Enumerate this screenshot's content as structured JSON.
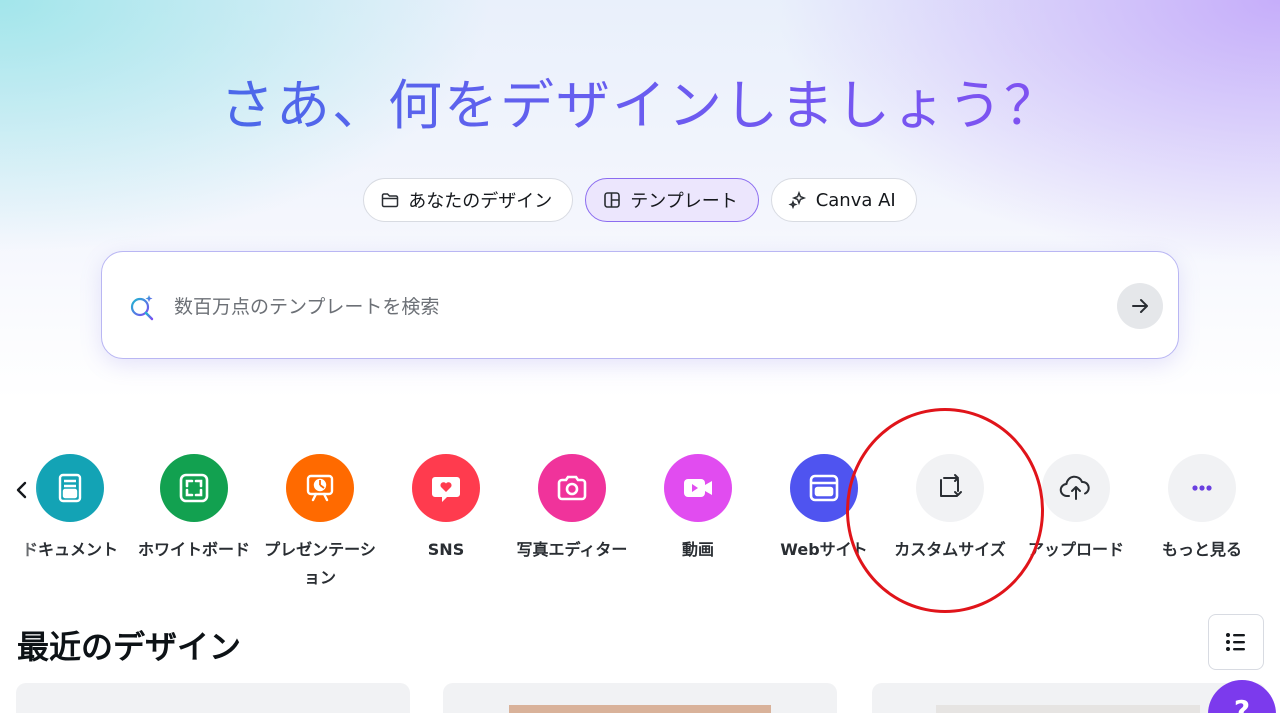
{
  "hero": {
    "headline": "さあ、何をデザインしましょう？"
  },
  "tabs": [
    {
      "label": "あなたのデザイン",
      "icon": "folder-icon",
      "active": false
    },
    {
      "label": "テンプレート",
      "icon": "template-icon",
      "active": true
    },
    {
      "label": "Canva AI",
      "icon": "sparkle-icon",
      "active": false
    }
  ],
  "search": {
    "placeholder": "数百万点のテンプレートを検索",
    "value": ""
  },
  "categories": [
    {
      "label": "ドキュメント",
      "icon": "document-icon",
      "color": "#13a3b5"
    },
    {
      "label": "ホワイトボード",
      "icon": "whiteboard-icon",
      "color": "#12a150"
    },
    {
      "label": "プレゼンテーション",
      "icon": "presentation-icon",
      "color": "#ff6a00"
    },
    {
      "label": "SNS",
      "icon": "heart-chat-icon",
      "color": "#ff3b4e"
    },
    {
      "label": "写真エディター",
      "icon": "camera-icon",
      "color": "#f0339b"
    },
    {
      "label": "動画",
      "icon": "video-icon",
      "color": "#e14cf0"
    },
    {
      "label": "Webサイト",
      "icon": "website-icon",
      "color": "#4f54f0"
    },
    {
      "label": "カスタムサイズ",
      "icon": "resize-icon",
      "color": "#f1f2f4"
    },
    {
      "label": "アップロード",
      "icon": "cloud-upload-icon",
      "color": "#f1f2f4"
    },
    {
      "label": "もっと見る",
      "icon": "more-icon",
      "color": "#f1f2f4"
    }
  ],
  "recent": {
    "title": "最近のデザイン"
  },
  "help": {
    "label": "?"
  }
}
